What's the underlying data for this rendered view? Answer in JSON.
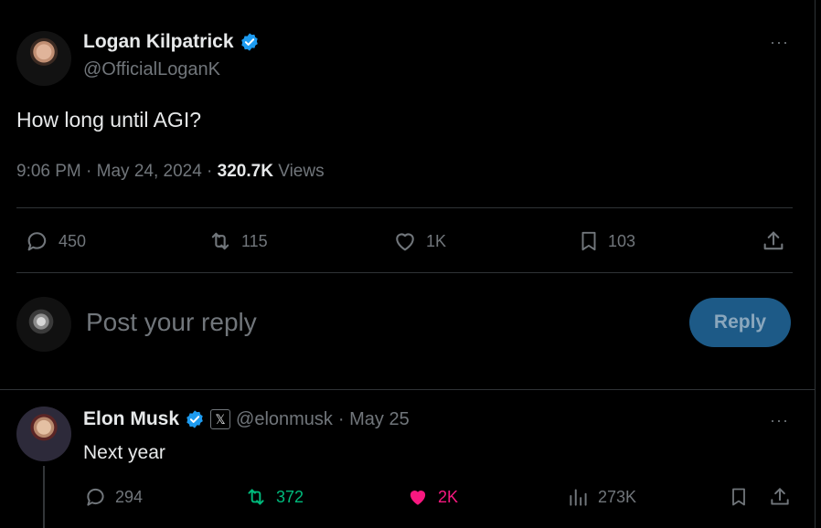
{
  "main_tweet": {
    "author_name": "Logan Kilpatrick",
    "author_handle": "@OfficialLoganK",
    "text": "How long until AGI?",
    "time": "9:06 PM · May 24, 2024 · ",
    "views_count": "320.7K",
    "views_label": "Views",
    "more": "···",
    "actions": {
      "replies": "450",
      "reposts": "115",
      "likes": "1K",
      "bookmarks": "103"
    }
  },
  "composer": {
    "placeholder": "Post your reply",
    "button_label": "Reply"
  },
  "reply": {
    "author_name": "Elon Musk",
    "affiliation_badge": "𝕏",
    "author_handle": "@elonmusk",
    "date": "· May 25",
    "text": "Next year",
    "more": "···",
    "actions": {
      "replies": "294",
      "reposts": "372",
      "likes": "2K",
      "views": "273K"
    }
  },
  "colors": {
    "background": "#000000",
    "verified": "#1d9bf0",
    "repost_active": "#00ba7c",
    "like_active": "#f91880",
    "reply_button": "#1d5a87"
  },
  "icons": [
    "verified-badge-icon",
    "more-icon",
    "reply-icon",
    "repost-icon",
    "like-icon",
    "bookmark-icon",
    "share-icon",
    "views-icon"
  ]
}
